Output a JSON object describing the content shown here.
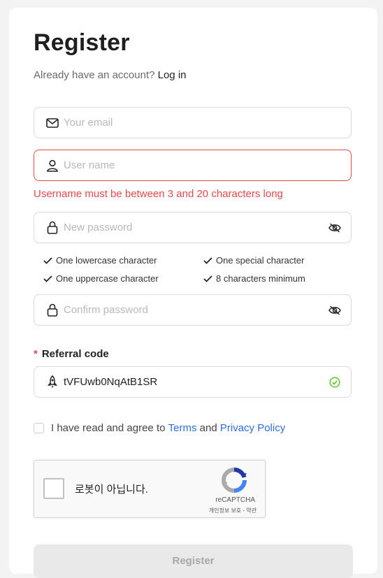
{
  "header": {
    "title": "Register",
    "subtitle_prefix": "Already have an account?",
    "login_link": "Log in"
  },
  "form": {
    "email": {
      "placeholder": "Your email",
      "icon": "mail-icon"
    },
    "username": {
      "placeholder": "User name",
      "icon": "user-icon",
      "error": "Username must be between 3 and 20 characters long"
    },
    "password": {
      "placeholder": "New password",
      "icon": "lock-icon",
      "toggle_icon": "eye-off-icon"
    },
    "password_rules": [
      "One lowercase character",
      "One special character",
      "One uppercase character",
      "8 characters minimum"
    ],
    "confirm_password": {
      "placeholder": "Confirm password",
      "icon": "lock-icon",
      "toggle_icon": "eye-off-icon"
    },
    "referral": {
      "label": "Referral code",
      "required_mark": "*",
      "value": "tVFUwb0NqAtB1SR",
      "icon": "rocket-icon",
      "status_icon": "check-circle-icon"
    },
    "agreement": {
      "prefix": "I have read and agree to",
      "terms": "Terms",
      "and": "and",
      "privacy": "Privacy Policy"
    },
    "recaptcha": {
      "label": "로봇이 아닙니다.",
      "brand": "reCAPTCHA",
      "links": "개인정보 보호 - 약관"
    },
    "submit_label": "Register"
  },
  "colors": {
    "error": "#e5484d",
    "link": "#2f6fdc",
    "success": "#52c41a",
    "border": "#d9d9d9"
  }
}
